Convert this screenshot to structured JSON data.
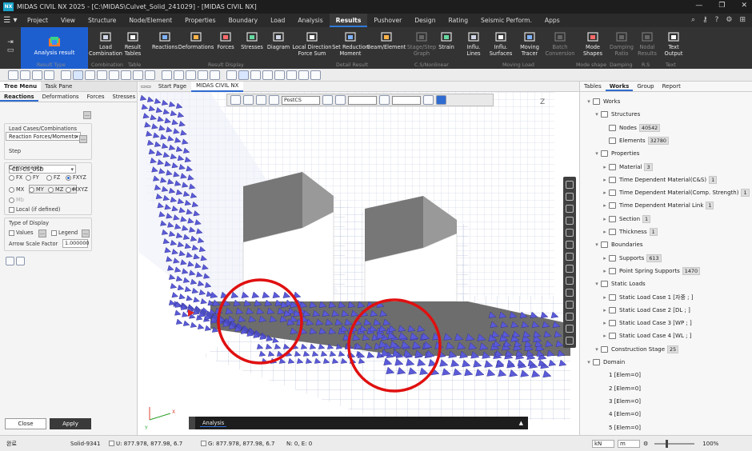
{
  "app": {
    "title": "MIDAS CIVIL NX 2025 - [C:\\MIDAS\\Culvet_Solid_241029] - [MIDAS CIVIL NX]",
    "logo_text": "NX"
  },
  "menu": {
    "items": [
      "Project",
      "View",
      "Structure",
      "Node/Element",
      "Properties",
      "Boundary",
      "Load",
      "Analysis",
      "Results",
      "Pushover",
      "Design",
      "Rating",
      "Seismic Perform.",
      "Apps"
    ],
    "active": "Results"
  },
  "ribbon": {
    "analysis_result": "Analysis result",
    "buttons": [
      {
        "label": "Load\nCombination",
        "icon": "load-combination-icon"
      },
      {
        "label": "Result\nTables",
        "icon": "result-tables-icon"
      },
      {
        "label": "Reactions",
        "icon": "reactions-icon"
      },
      {
        "label": "Deformations",
        "icon": "deformations-icon"
      },
      {
        "label": "Forces",
        "icon": "forces-icon"
      },
      {
        "label": "Stresses",
        "icon": "stresses-icon"
      },
      {
        "label": "Diagram",
        "icon": "diagram-icon"
      },
      {
        "label": "Local Direction\nForce Sum",
        "icon": "local-direction-force-sum-icon"
      },
      {
        "label": "Set Reduction\nMoment",
        "icon": "set-reduction-moment-icon"
      },
      {
        "label": "Beam/Element",
        "icon": "beam-element-icon"
      },
      {
        "label": "Stage/Step\nGraph",
        "icon": "stage-step-graph-icon",
        "disabled": true
      },
      {
        "label": "Strain",
        "icon": "strain-icon"
      },
      {
        "label": "Influ.\nLines",
        "icon": "influence-lines-icon"
      },
      {
        "label": "Influ.\nSurfaces",
        "icon": "influence-surfaces-icon"
      },
      {
        "label": "Moving\nTracer",
        "icon": "moving-tracer-icon"
      },
      {
        "label": "Batch\nConversion",
        "icon": "batch-conversion-icon",
        "disabled": true
      },
      {
        "label": "Mode\nShapes",
        "icon": "mode-shapes-icon"
      },
      {
        "label": "Damping\nRatio",
        "icon": "damping-ratio-icon",
        "disabled": true
      },
      {
        "label": "Nodal\nResults",
        "icon": "nodal-results-icon",
        "disabled": true
      },
      {
        "label": "Text\nOutput",
        "icon": "text-output-icon"
      }
    ],
    "groups": [
      "Result Type",
      "Combination",
      "Table",
      "Result Display",
      "Detail Result",
      "C.S/Nonlinear",
      "Moving Load",
      "Mode shape",
      "Damping",
      "R.S",
      "Text"
    ]
  },
  "left": {
    "tabs": [
      "Tree Menu",
      "Task Pane"
    ],
    "subtabs": [
      "Reactions",
      "Deformations",
      "Forces",
      "Stresses"
    ],
    "result_type": "Reaction Forces/Moments",
    "load_cases_label": "Load Cases/Combinations",
    "load_case": "CB: CS_USD",
    "step_label": "Step",
    "components_label": "Components",
    "components": [
      "FX",
      "FY",
      "FZ",
      "FXYZ",
      "MX",
      "MY",
      "MZ",
      "MXYZ",
      "Mb"
    ],
    "selected_component": "FXYZ",
    "local_label": "Local (if defined)",
    "display_label": "Type of Display",
    "values_label": "Values",
    "legend_label": "Legend",
    "arrow_scale_label": "Arrow Scale Factor",
    "arrow_scale": "1.000000",
    "close": "Close",
    "apply": "Apply"
  },
  "viewtabs": [
    "Start Page",
    "MIDAS CIVIL NX"
  ],
  "viewport": {
    "stage_combo": "PostCS",
    "analysis_tab": "Analysis",
    "axis_z": "Z",
    "axis_x": "X",
    "axis_y": "Y"
  },
  "right": {
    "tabs": [
      "Tables",
      "Works",
      "Group",
      "Report"
    ],
    "active_tab": "Works",
    "tree": [
      {
        "level": 0,
        "label": "Works",
        "icon": "works-icon"
      },
      {
        "level": 1,
        "label": "Structures",
        "icon": "structures-icon"
      },
      {
        "level": 2,
        "label": "Nodes",
        "count": "40542",
        "icon": "nodes-icon"
      },
      {
        "level": 2,
        "label": "Elements",
        "count": "32780",
        "icon": "elements-icon"
      },
      {
        "level": 1,
        "label": "Properties",
        "icon": "properties-icon"
      },
      {
        "level": 2,
        "label": "Material",
        "count": "3",
        "icon": "material-icon"
      },
      {
        "level": 2,
        "label": "Time Dependent Material(C&S)",
        "count": "1",
        "icon": "time-dependent-material-icon"
      },
      {
        "level": 2,
        "label": "Time Dependent Material(Comp. Strength)",
        "count": "1",
        "icon": "time-dependent-strength-icon"
      },
      {
        "level": 2,
        "label": "Time Dependent Material Link",
        "count": "1",
        "icon": "material-link-icon"
      },
      {
        "level": 2,
        "label": "Section",
        "count": "1",
        "icon": "section-icon"
      },
      {
        "level": 2,
        "label": "Thickness",
        "count": "1",
        "icon": "thickness-icon"
      },
      {
        "level": 1,
        "label": "Boundaries",
        "icon": "boundaries-icon"
      },
      {
        "level": 2,
        "label": "Supports",
        "count": "613",
        "icon": "supports-icon"
      },
      {
        "level": 2,
        "label": "Point Spring Supports",
        "count": "1470",
        "icon": "point-spring-icon"
      },
      {
        "level": 1,
        "label": "Static Loads",
        "icon": "static-loads-icon"
      },
      {
        "level": 2,
        "label": "Static Load Case 1 [자중 ; ]",
        "icon": "load-case-icon"
      },
      {
        "level": 2,
        "label": "Static Load Case 2 [DL ; ]",
        "icon": "load-case-icon"
      },
      {
        "level": 2,
        "label": "Static Load Case 3 [WP ; ]",
        "icon": "load-case-icon"
      },
      {
        "level": 2,
        "label": "Static Load Case 4 [WL ; ]",
        "icon": "load-case-icon"
      },
      {
        "level": 1,
        "label": "Construction Stage",
        "count": "25",
        "icon": "construction-stage-icon"
      },
      {
        "level": 0,
        "label": "Domain",
        "icon": "domain-icon"
      },
      {
        "level": 2,
        "label": "1 [Elem=0]",
        "icon": ""
      },
      {
        "level": 2,
        "label": "2 [Elem=0]",
        "icon": ""
      },
      {
        "level": 2,
        "label": "3 [Elem=0]",
        "icon": ""
      },
      {
        "level": 2,
        "label": "4 [Elem=0]",
        "icon": ""
      },
      {
        "level": 2,
        "label": "5 [Elem=0]",
        "icon": ""
      }
    ]
  },
  "status": {
    "left": "완료",
    "selected": "Solid-9341",
    "u_coord": "U: 877.978, 877.98, 6.7",
    "g_coord": "G: 877.978, 877.98, 6.7",
    "ne": "N: 0, E: 0",
    "force_unit": "kN",
    "length_unit": "m",
    "zoom": "100%"
  },
  "colors": {
    "accent": "#2f6bd0",
    "support_glyph": "#5a5ad8",
    "highlight_circle": "#e01010",
    "mesh": "#9aa7c8"
  }
}
